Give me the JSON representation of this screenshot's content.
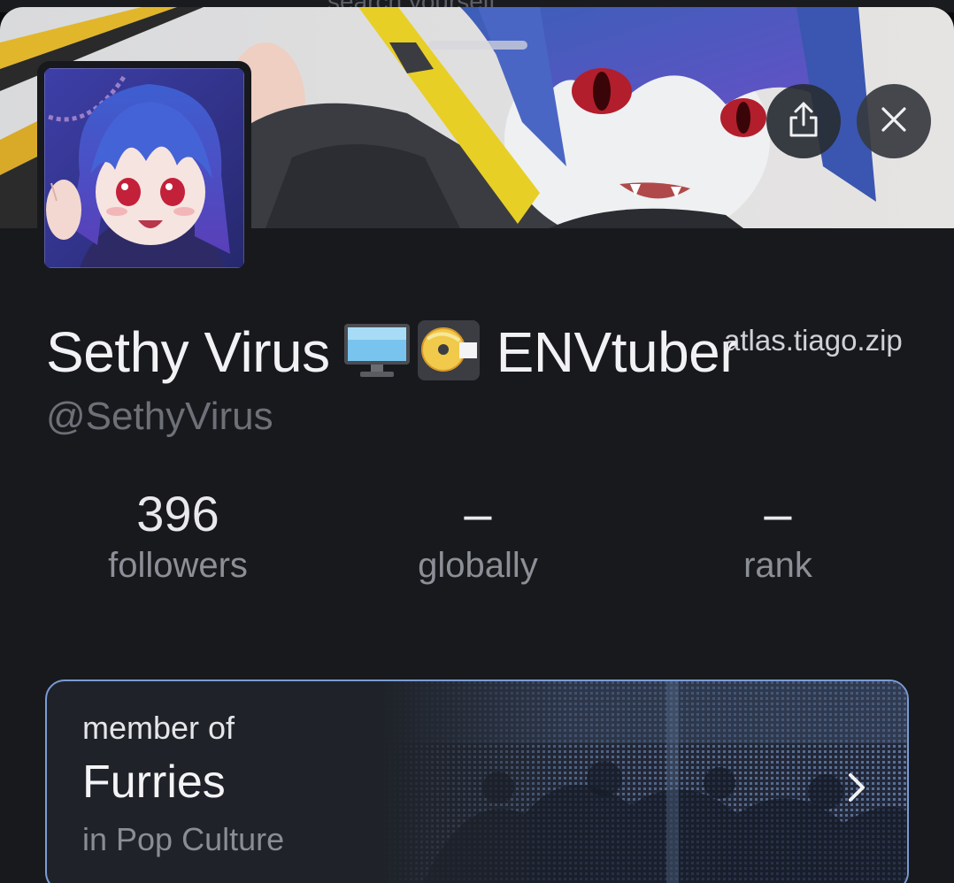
{
  "background_app": {
    "search_placeholder": "search yourself"
  },
  "profile": {
    "display_name": "Sethy Virus",
    "name_emojis": [
      "desktop-computer-emoji",
      "dvd-emoji"
    ],
    "name_suffix": "ENVtuber",
    "handle": "@SethyVirus",
    "watermark": "atlas.tiago.zip"
  },
  "stats": [
    {
      "value": "396",
      "label": "followers"
    },
    {
      "value": "–",
      "label": "globally"
    },
    {
      "value": "–",
      "label": "rank"
    }
  ],
  "community": {
    "subtitle": "member of",
    "name": "Furries",
    "category": "in Pop Culture"
  },
  "icons": {
    "share": "share-icon",
    "close": "close-icon",
    "chevron": "chevron-right-icon"
  },
  "colors": {
    "sheet_background": "#17191d",
    "card_border": "#7a9bd4",
    "muted_text": "#8c8f96"
  }
}
